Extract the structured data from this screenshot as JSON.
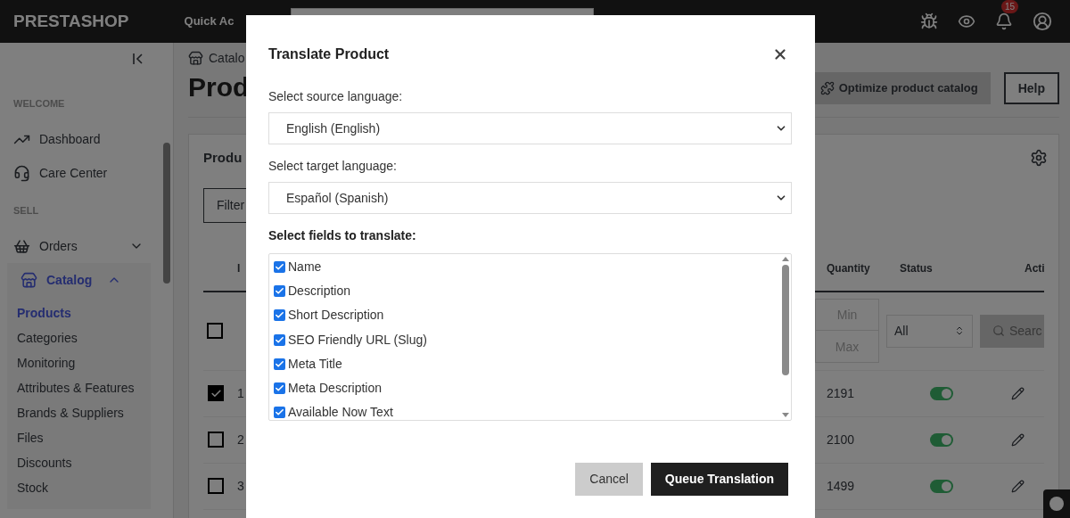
{
  "header": {
    "logo": "PRESTASHOP",
    "quick_access": "Quick Ac",
    "notifications_count": "15"
  },
  "sidebar": {
    "sections": [
      {
        "title": "WELCOME",
        "items": [
          {
            "label": "Dashboard",
            "selected": false
          },
          {
            "label": "Care Center",
            "selected": false
          }
        ]
      },
      {
        "title": "SELL",
        "items": [
          {
            "label": "Orders",
            "selected": false,
            "expanded": false
          },
          {
            "label": "Catalog",
            "selected": true,
            "expanded": true,
            "children": [
              {
                "label": "Products",
                "selected": true
              },
              {
                "label": "Categories",
                "selected": false
              },
              {
                "label": "Monitoring",
                "selected": false
              },
              {
                "label": "Attributes & Features",
                "selected": false
              },
              {
                "label": "Brands & Suppliers",
                "selected": false
              },
              {
                "label": "Files",
                "selected": false
              },
              {
                "label": "Discounts",
                "selected": false
              },
              {
                "label": "Stock",
                "selected": false
              }
            ]
          }
        ]
      }
    ]
  },
  "main": {
    "breadcrumb": "Catalo",
    "title": "Prod",
    "toolbar": [
      "Optimize product catalog",
      "Help"
    ],
    "card": {
      "title": "Produ",
      "filter_button": "Filter",
      "columns": [
        "I",
        "Quantity",
        "Status",
        "Acti"
      ],
      "filters": {
        "select_all": false,
        "min_placeholder": "Min",
        "max_placeholder": "Max",
        "status": "All",
        "search_button": "Searc"
      },
      "rows": [
        {
          "selected": true,
          "id": "1",
          "quantity": "2191",
          "on": true
        },
        {
          "selected": false,
          "id": "2",
          "quantity": "2100",
          "on": true
        },
        {
          "selected": false,
          "id": "3",
          "quantity": "1499",
          "on": true
        }
      ]
    }
  },
  "modal": {
    "title": "Translate Product",
    "source_label": "Select source language:",
    "source_value": "English (English)",
    "target_label": "Select target language:",
    "target_value": "Español (Spanish)",
    "fields_label": "Select fields to translate:",
    "fields": [
      {
        "label": "Name",
        "checked": true
      },
      {
        "label": "Description",
        "checked": true
      },
      {
        "label": "Short Description",
        "checked": true
      },
      {
        "label": "SEO Friendly URL (Slug)",
        "checked": true
      },
      {
        "label": "Meta Title",
        "checked": true
      },
      {
        "label": "Meta Description",
        "checked": true
      },
      {
        "label": "Available Now Text",
        "checked": true
      }
    ],
    "buttons": [
      "Cancel",
      "Queue Translation"
    ]
  }
}
